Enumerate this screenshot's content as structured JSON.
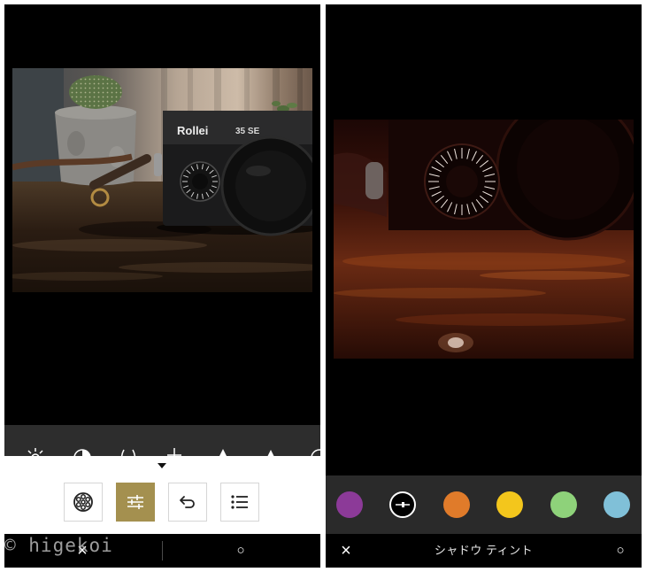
{
  "accent_color": "#a4904f",
  "watermark": "© higekoi",
  "left": {
    "photo": {
      "camera_logo": "Rollei",
      "camera_model": "35 SE"
    },
    "tool_strip_icons": [
      "sun-icon",
      "contrast-icon",
      "curves-icon",
      "tune-icon",
      "triangle-icon",
      "triangle-icon",
      "circle-icon"
    ],
    "active_tab_index": 1,
    "tabs": [
      {
        "icon": "reel-icon"
      },
      {
        "icon": "sliders-icon"
      },
      {
        "icon": "undo-icon"
      },
      {
        "icon": "list-icon"
      }
    ],
    "bottom_bar": {
      "cancel": "×",
      "confirm": "○"
    }
  },
  "right": {
    "swatches": [
      {
        "color": "#8c3a98"
      },
      {
        "color": "#000000",
        "selected": true
      },
      {
        "color": "#e07b2a"
      },
      {
        "color": "#f3c61c"
      },
      {
        "color": "#8ed27a"
      },
      {
        "color": "#80c0d8"
      }
    ],
    "bottom_bar": {
      "cancel": "×",
      "title": "シャドウ ティント",
      "confirm": "○"
    }
  }
}
